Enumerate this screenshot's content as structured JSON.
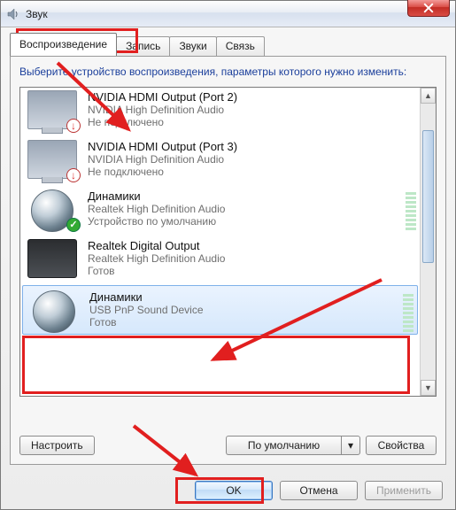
{
  "window": {
    "title": "Звук"
  },
  "tabs": [
    {
      "label": "Воспроизведение",
      "active": true
    },
    {
      "label": "Запись",
      "active": false
    },
    {
      "label": "Звуки",
      "active": false
    },
    {
      "label": "Связь",
      "active": false
    }
  ],
  "instruction": "Выберите устройство воспроизведения, параметры которого нужно изменить:",
  "devices": [
    {
      "name": "NVIDIA HDMI Output (Port 2)",
      "desc": "NVIDIA High Definition Audio",
      "status": "Не подключено",
      "icon": "monitor",
      "badge": "down",
      "selected": false
    },
    {
      "name": "NVIDIA HDMI Output (Port 3)",
      "desc": "NVIDIA High Definition Audio",
      "status": "Не подключено",
      "icon": "monitor",
      "badge": "down",
      "selected": false
    },
    {
      "name": "Динамики",
      "desc": "Realtek High Definition Audio",
      "status": "Устройство по умолчанию",
      "icon": "speaker",
      "badge": "check",
      "selected": false,
      "level": true
    },
    {
      "name": "Realtek Digital Output",
      "desc": "Realtek High Definition Audio",
      "status": "Готов",
      "icon": "amp",
      "badge": "",
      "selected": false
    },
    {
      "name": "Динамики",
      "desc": "USB PnP Sound Device",
      "status": "Готов",
      "icon": "speaker",
      "badge": "",
      "selected": true,
      "level": true
    }
  ],
  "panel_buttons": {
    "configure": "Настроить",
    "set_default": "По умолчанию",
    "dropdown_glyph": "▾",
    "properties": "Свойства"
  },
  "dialog_buttons": {
    "ok": "OK",
    "cancel": "Отмена",
    "apply": "Применить"
  },
  "scrollbar": {
    "up_glyph": "▲",
    "down_glyph": "▼"
  },
  "annotations": {
    "color": "#e11f1f"
  }
}
